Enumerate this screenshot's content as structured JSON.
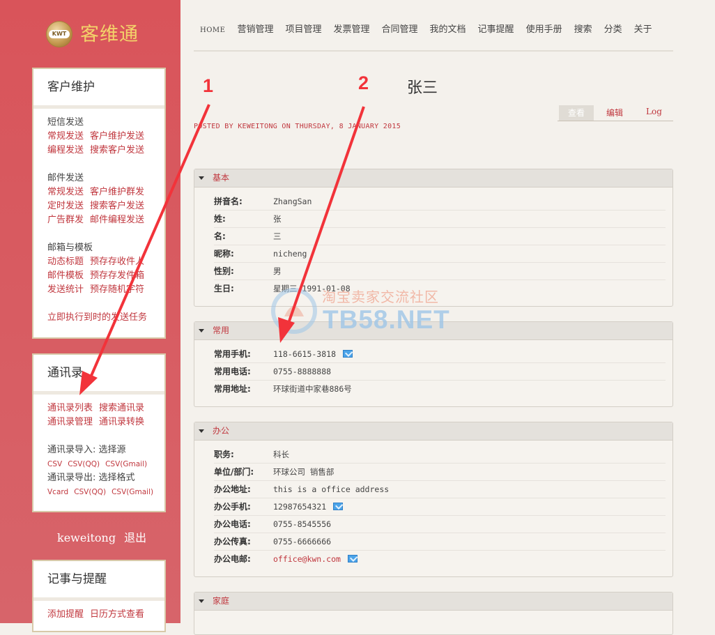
{
  "brand": {
    "logo_text": "客维通",
    "badge_text": "KWT"
  },
  "nav": [
    "HOME",
    "营销管理",
    "项目管理",
    "发票管理",
    "合同管理",
    "我的文档",
    "记事提醒",
    "使用手册",
    "搜索",
    "分类",
    "关于"
  ],
  "sidebar": {
    "customer": {
      "title": "客户维护",
      "sms_label": "短信发送",
      "sms_links": [
        [
          "常规发送",
          "客户维护发送"
        ],
        [
          "编程发送",
          "搜索客户发送"
        ]
      ],
      "mail_label": "邮件发送",
      "mail_links": [
        [
          "常规发送",
          "客户维护群发"
        ],
        [
          "定时发送",
          "搜索客户发送"
        ],
        [
          "广告群发",
          "邮件编程发送"
        ]
      ],
      "template_label": "邮箱与模板",
      "template_links": [
        [
          "动态标题",
          "预存存收件人"
        ],
        [
          "邮件模板",
          "预存存发件箱"
        ],
        [
          "发送统计",
          "预存随机字符"
        ]
      ],
      "run_task": "立即执行到时的发送任务"
    },
    "contacts": {
      "title": "通讯录",
      "links": [
        [
          "通讯录列表",
          "搜索通讯录"
        ],
        [
          "通讯录管理",
          "通讯录转换"
        ]
      ],
      "import_label": "通讯录导入: 选择源",
      "import_links": [
        "CSV",
        "CSV(QQ)",
        "CSV(Gmail)"
      ],
      "export_label": "通讯录导出: 选择格式",
      "export_links": [
        "Vcard",
        "CSV(QQ)",
        "CSV(Gmail)"
      ]
    },
    "user": {
      "name": "keweitong",
      "logout": "退出"
    },
    "notes": {
      "title": "记事与提醒",
      "links": [
        "添加提醒",
        "日历方式查看"
      ]
    }
  },
  "page": {
    "title": "张三",
    "posted": "POSTED BY KEWEITONG ON THURSDAY, 8 JANUARY 2015",
    "tabs": {
      "view": "查看",
      "edit": "编辑",
      "log": "Log"
    }
  },
  "sections": {
    "basic": {
      "title": "基本",
      "fields": [
        {
          "k": "拼音名:",
          "v": "ZhangSan"
        },
        {
          "k": "姓:",
          "v": "张"
        },
        {
          "k": "名:",
          "v": "三"
        },
        {
          "k": "昵称:",
          "v": "nicheng"
        },
        {
          "k": "性别:",
          "v": "男"
        },
        {
          "k": "生日:",
          "v": "星期三  1991-01-08"
        }
      ]
    },
    "common": {
      "title": "常用",
      "fields": [
        {
          "k": "常用手机:",
          "v": "118-6615-3818"
        },
        {
          "k": "常用电话:",
          "v": "0755-8888888"
        },
        {
          "k": "常用地址:",
          "v": "环球街道中家巷886号"
        }
      ]
    },
    "office": {
      "title": "办公",
      "fields": [
        {
          "k": "职务:",
          "v": "科长"
        },
        {
          "k": "单位/部门:",
          "v": "环球公司 销售部"
        },
        {
          "k": "办公地址:",
          "v": "this is a office address"
        },
        {
          "k": "办公手机:",
          "v": "12987654321"
        },
        {
          "k": "办公电话:",
          "v": "0755-8545556"
        },
        {
          "k": "办公传真:",
          "v": "0755-6666666"
        },
        {
          "k": "办公电邮:",
          "v": "office@kwn.com"
        }
      ]
    },
    "family": {
      "title": "家庭"
    }
  },
  "annotations": {
    "one": "1",
    "two": "2"
  },
  "watermark": {
    "cn": "淘宝卖家交流社区",
    "en": "TB58.NET"
  },
  "colors": {
    "sidebar": "#d9545a",
    "link": "#c0373e",
    "arrow": "#f2333a",
    "gold": "#f3d26a"
  }
}
